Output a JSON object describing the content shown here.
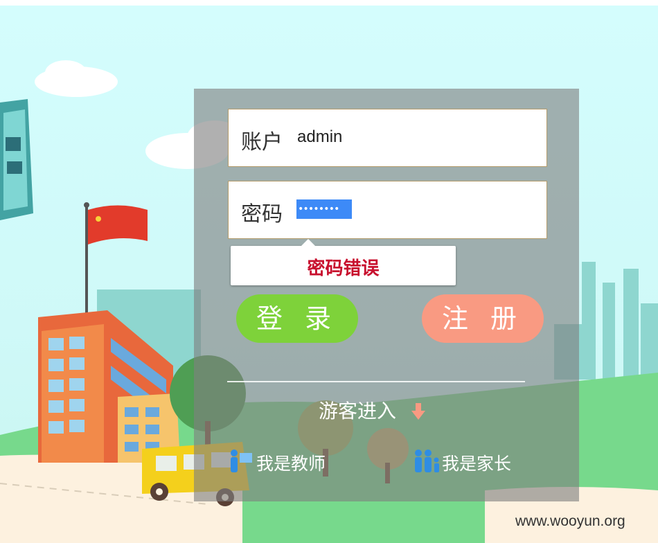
{
  "login_form": {
    "username_label": "账户",
    "username_value": "admin",
    "password_label": "密码",
    "password_mask": "••••••••",
    "error_message": "密码错误",
    "login_button": "登 录",
    "register_button": "注 册",
    "guest_label": "游客进入",
    "roles": {
      "teacher": "我是教师",
      "parent": "我是家长"
    }
  },
  "watermark": "www.wooyun.org",
  "colors": {
    "login_button": "#7ed23a",
    "register_button": "#f99a82",
    "error_text": "#c8102e",
    "selection": "#3d8af7",
    "role_icon": "#2f8de4"
  }
}
